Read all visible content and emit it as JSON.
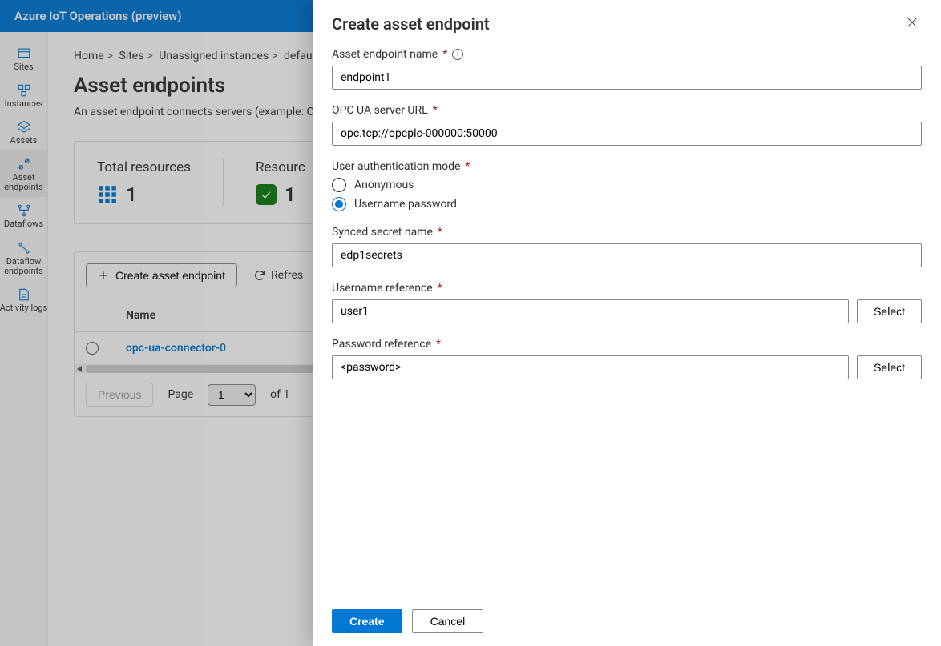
{
  "appbar": {
    "title": "Azure IoT Operations (preview)"
  },
  "sidenav": [
    {
      "key": "sites",
      "label": "Sites",
      "selected": false
    },
    {
      "key": "instances",
      "label": "Instances",
      "selected": false
    },
    {
      "key": "assets",
      "label": "Assets",
      "selected": false
    },
    {
      "key": "asset-endpoints",
      "label": "Asset endpoints",
      "selected": true
    },
    {
      "key": "dataflows",
      "label": "Dataflows",
      "selected": false
    },
    {
      "key": "dataflow-endpoints",
      "label": "Dataflow endpoints",
      "selected": false
    },
    {
      "key": "activity-logs",
      "label": "Activity logs",
      "selected": false
    }
  ],
  "breadcrumb": [
    "Home",
    "Sites",
    "Unassigned instances",
    "default"
  ],
  "page": {
    "title": "Asset endpoints",
    "description": "An asset endpoint connects servers (example: O"
  },
  "cards": {
    "total": {
      "title": "Total resources",
      "count": "1"
    },
    "healthy": {
      "title": "Resourc",
      "count": "1"
    }
  },
  "toolbar": {
    "create": "Create asset endpoint",
    "refresh": "Refres"
  },
  "table": {
    "header": {
      "name": "Name"
    },
    "rows": [
      {
        "name": "opc-ua-connector-0"
      }
    ]
  },
  "pager": {
    "previous": "Previous",
    "page_label": "Page",
    "page_value": "1",
    "of_label": "of 1"
  },
  "flyout": {
    "title": "Create asset endpoint",
    "labels": {
      "endpoint_name": "Asset endpoint name",
      "server_url": "OPC UA server URL",
      "auth_mode": "User authentication mode",
      "anonymous": "Anonymous",
      "userpass": "Username password",
      "secret_name": "Synced secret name",
      "username_ref": "Username reference",
      "password_ref": "Password reference",
      "select": "Select",
      "create": "Create",
      "cancel": "Cancel"
    },
    "values": {
      "endpoint_name": "endpoint1",
      "server_url": "opc.tcp://opcplc-000000:50000",
      "auth_mode": "userpass",
      "secret_name": "edp1secrets",
      "username_ref": "user1",
      "password_ref": "<password>"
    }
  }
}
